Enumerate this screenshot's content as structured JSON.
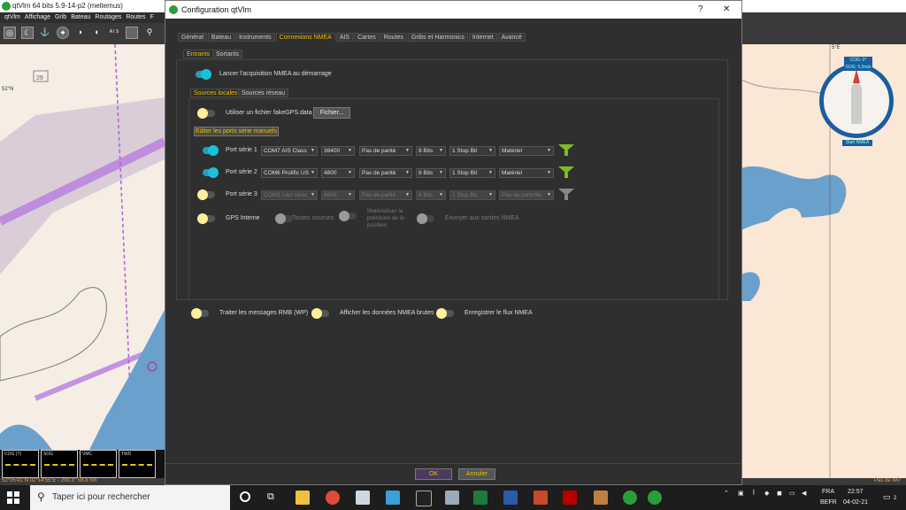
{
  "app": {
    "title": "qtVlm 64 bits 5.9-14-p2 (meltemus)",
    "menu": [
      "qtVlm",
      "Affichage",
      "Grib",
      "Bateau",
      "Routages",
      "Routes",
      "F"
    ],
    "toolbar_icons": [
      "target-icon",
      "moon-icon",
      "anchor-icon",
      "compass-icon",
      "sail-icon",
      "sail2-icon",
      "ais-icon",
      "square-icon",
      "search-icon"
    ],
    "toolbar_ais_label": "A I S",
    "statusbar": "52°05'41\"N 02°14'55\"E - 299.3° 58.8 nm",
    "statusbar_right": "Pas de WP",
    "instruments": [
      "COG (T)",
      "SOG",
      "VMC",
      "TWD"
    ],
    "compass": {
      "cog": "COG: 0°",
      "sog": "SOG: 0,0nds",
      "button": "Start NMEA",
      "lat_label": "5°E"
    }
  },
  "dialog": {
    "title": "Configuration qtVlm",
    "help": "?",
    "close": "✕",
    "tabs": [
      "Général",
      "Bateau",
      "Instruments",
      "Connexions NMEA",
      "AIS",
      "Cartes",
      "Routes",
      "Gribs et Harmonics",
      "Internet",
      "Avancé"
    ],
    "active_tab": "Connexions NMEA",
    "subtabs": [
      "Entrants",
      "Sortants"
    ],
    "launch_label": "Lancer l'acquisition NMEA au démarrage",
    "launch_on": true,
    "source_tabs": [
      "Sources locales",
      "Sources réseau"
    ],
    "file_label": "Utiliser un fichier",
    "file_name": "fakeGPS.data",
    "file_button": "Fichier...",
    "edit_manual_label": "Editer les ports série manuels",
    "ports": [
      {
        "label": "Port série 1",
        "on": true,
        "port": "COM7 AIS Class",
        "baud": "38400",
        "parity": "Pas de parité",
        "bits": "8 Bits",
        "stop": "1 Stop Bit",
        "flow": "Matériel",
        "enabled": true
      },
      {
        "label": "Port série 2",
        "on": true,
        "port": "COM6 Prolific US",
        "baud": "4800",
        "parity": "Pas de parité",
        "bits": "8 Bits",
        "stop": "1 Stop Bit",
        "flow": "Matériel",
        "enabled": true
      },
      {
        "label": "Port série 3",
        "on": false,
        "port": "COM3 Lien série",
        "baud": "4800",
        "parity": "Pas de parité",
        "bits": "8 Bits",
        "stop": "1 Stop Bit",
        "flow": "Pas de contrôle",
        "enabled": false
      }
    ],
    "gps_label": "GPS Interne",
    "all_sources_label": "Toutes sources",
    "materialize_label": [
      "Matérialiser la",
      "précision de la",
      "position"
    ],
    "send_label": "Envoyer aux sorties NMEA",
    "bottom_toggles": [
      "Traiter les messages RMB (WP)",
      "Afficher les données NMEA brutes",
      "Enregistrer le flux NMEA"
    ],
    "ok": "OK",
    "cancel": "Annuler"
  },
  "taskbar": {
    "search_placeholder": "Taper ici pour rechercher",
    "lang": "FRA",
    "locale": "BEFR",
    "time": "22:57",
    "date": "04-02-21",
    "notifications": "2"
  }
}
